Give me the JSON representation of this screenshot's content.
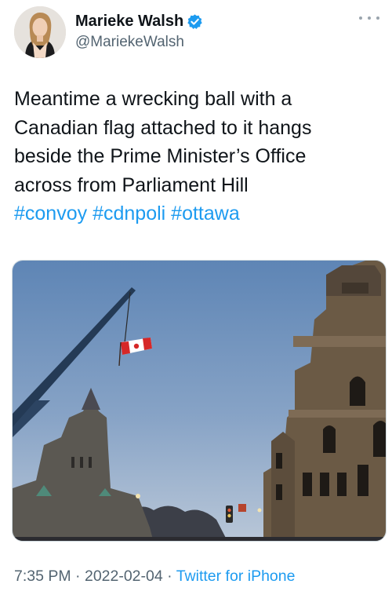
{
  "author": {
    "display_name": "Marieke Walsh",
    "handle": "@MariekeWalsh",
    "verified": true
  },
  "tweet": {
    "lines": [
      "Meantime a wrecking ball with a",
      "Canadian flag attached to it hangs",
      "beside the Prime Minister’s Office",
      "across from Parliament Hill"
    ],
    "hashtags": [
      "#convoy",
      "#cdnpoli",
      "#ottawa"
    ]
  },
  "meta": {
    "time": "7:35 PM",
    "separator": "·",
    "date": "2022-02-04",
    "source": "Twitter for iPhone"
  },
  "icons": {
    "verified": "verified-badge-icon",
    "more": "more-options-icon"
  },
  "colors": {
    "link": "#1d9bf0",
    "secondary_text": "#536471",
    "verified": "#1d9bf0"
  }
}
